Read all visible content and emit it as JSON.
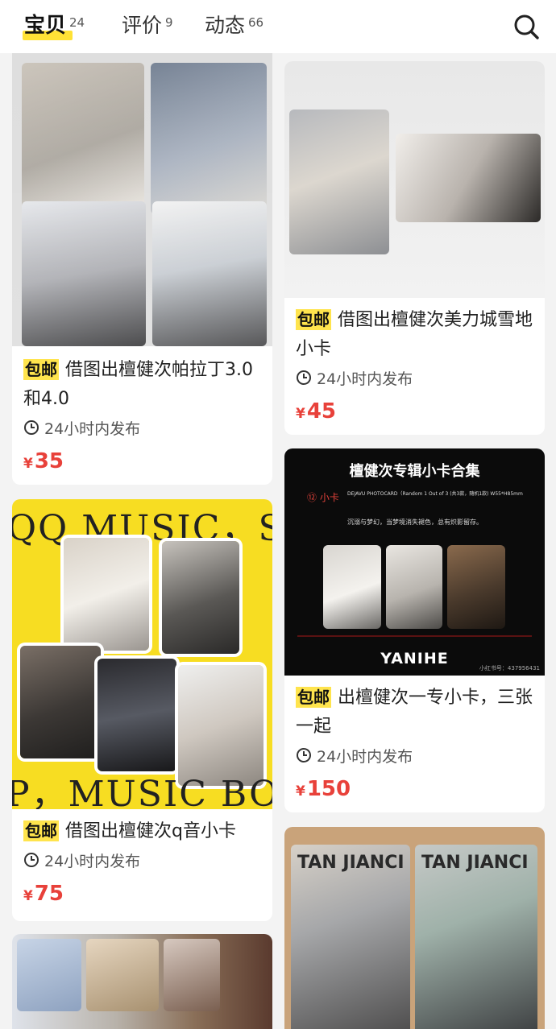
{
  "tabs": [
    {
      "label": "宝贝",
      "count": "24"
    },
    {
      "label": "评价",
      "count": "9"
    },
    {
      "label": "动态",
      "count": "66"
    }
  ],
  "icons": {
    "search": "search-icon",
    "clock": "clock-icon"
  },
  "colors": {
    "accent_yellow": "#ffe236",
    "price_red": "#e8413a"
  },
  "listings": [
    {
      "badge": "包邮",
      "title": "借图出檀健次帕拉丁3.0和4.0",
      "time": "24小时内发布",
      "currency": "¥",
      "price": "35"
    },
    {
      "badge": "包邮",
      "title": "借图出檀健次美力城雪地小卡",
      "time": "24小时内发布",
      "currency": "¥",
      "price": "45"
    },
    {
      "badge": "包邮",
      "title": "借图出檀健次q音小卡",
      "time": "24小时内发布",
      "currency": "¥",
      "price": "75",
      "image_text": {
        "banner_top": "QQ MUSIC，S",
        "banner_bottom": "P，MUSIC BO"
      }
    },
    {
      "badge": "包邮",
      "title": "出檀健次一专小卡，三张一起",
      "time": "24小时内发布",
      "currency": "¥",
      "price": "150",
      "image_text": {
        "header": "檀健次专辑小卡合集",
        "item_no": "⑫ 小卡",
        "spec": "DEJAVU PHOTOCARD（Random 1 Out of 3 (共3款，随机1款)  W55*H85mm",
        "desc": "沉溺与梦幻，当梦境消失褪色，总有炽影留存。",
        "brand": "YANIHE",
        "rednote_id": "小红书号：437956431"
      }
    },
    {
      "image_text": {
        "card_left": "TAN JIANCI",
        "card_right": "TAN JIANCI"
      }
    }
  ]
}
